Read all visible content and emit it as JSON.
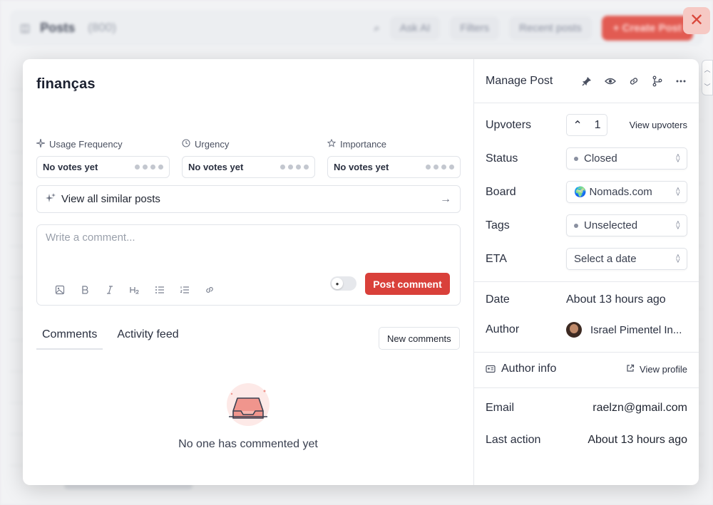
{
  "background": {
    "title": "Posts",
    "count": "(800)",
    "chips": [
      "Ask AI",
      "Filters",
      "Recent posts"
    ],
    "create_label": "+ Create Post"
  },
  "post": {
    "title": "finanças",
    "votes": [
      {
        "label": "Usage Frequency",
        "value": "No votes yet"
      },
      {
        "label": "Urgency",
        "value": "No votes yet"
      },
      {
        "label": "Importance",
        "value": "No votes yet"
      }
    ],
    "similar_label": "View all similar posts",
    "comment_placeholder": "Write a comment...",
    "post_comment_label": "Post comment",
    "tabs": [
      "Comments",
      "Activity feed"
    ],
    "new_comments_label": "New comments",
    "empty_text": "No one has commented yet"
  },
  "manage": {
    "title": "Manage Post",
    "upvoters_label": "Upvoters",
    "upvote_count": "1",
    "view_upvoters": "View upvoters",
    "status_label": "Status",
    "status_value": "Closed",
    "board_label": "Board",
    "board_value": "Nomads.com",
    "tags_label": "Tags",
    "tags_value": "Unselected",
    "eta_label": "ETA",
    "eta_value": "Select a date",
    "date_label": "Date",
    "date_value": "About 13 hours ago",
    "author_label": "Author",
    "author_value": "Israel Pimentel In...",
    "author_info_label": "Author info",
    "view_profile": "View profile",
    "email_label": "Email",
    "email_value": "raelzn@gmail.com",
    "last_action_label": "Last action",
    "last_action_value": "About 13 hours ago"
  },
  "colors": {
    "accent": "#d9403a",
    "border": "#e1e4e9",
    "text": "#1f2430"
  }
}
